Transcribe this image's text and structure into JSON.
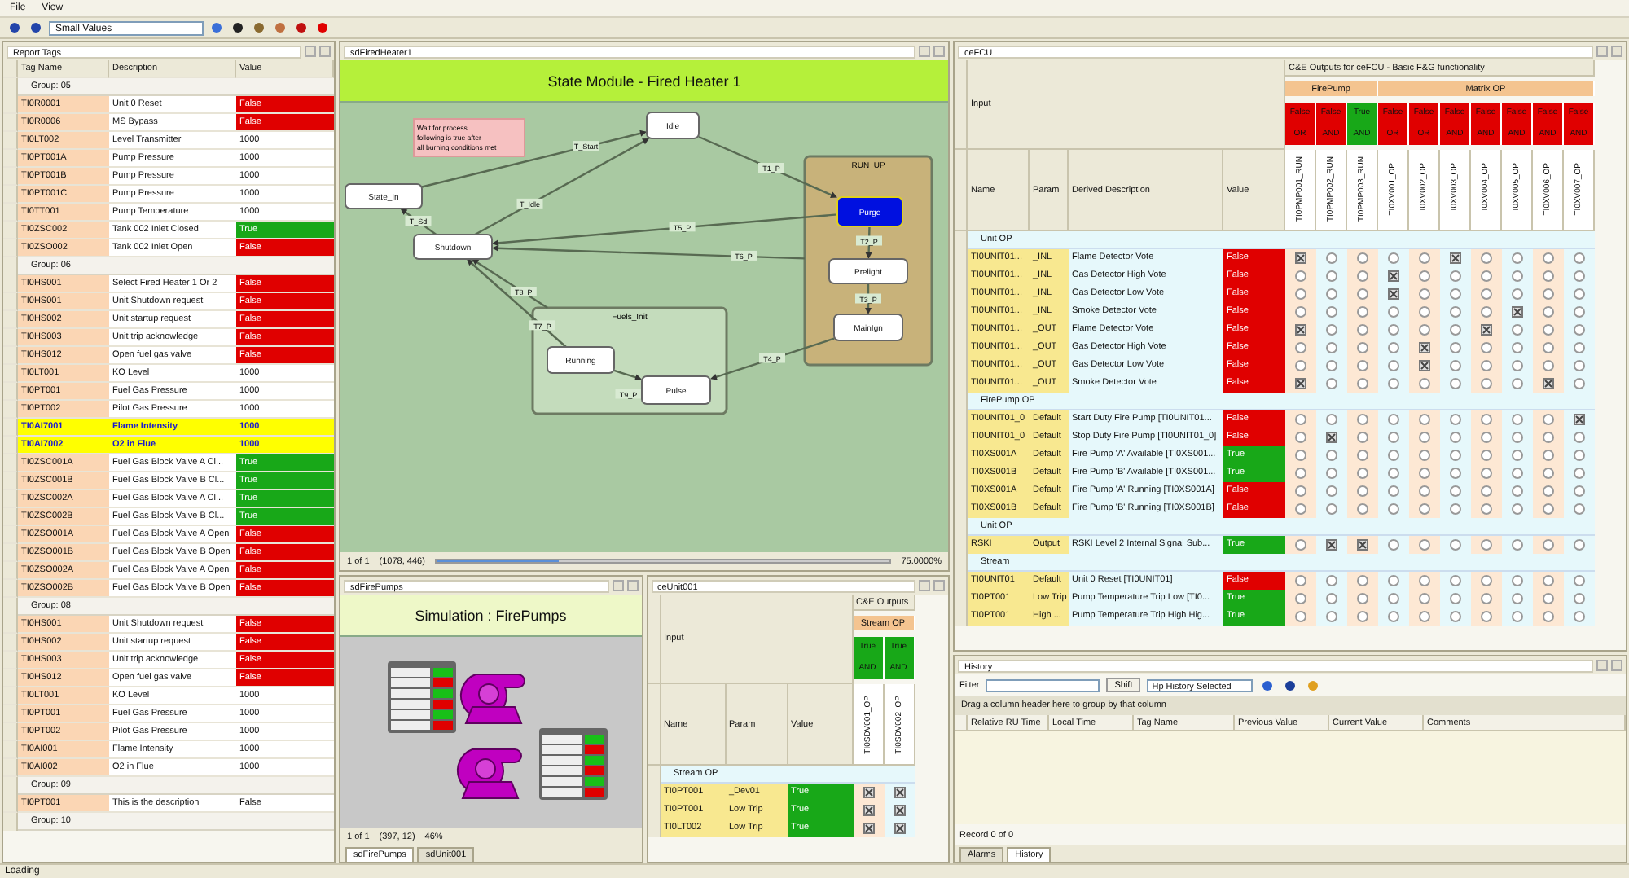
{
  "menu": [
    {
      "label": "File"
    },
    {
      "label": "View"
    }
  ],
  "toolbar": {
    "dropdown": "Small Values"
  },
  "report_tags": {
    "title": "Report Tags",
    "columns": [
      "Tag Name",
      "Description",
      "Value"
    ],
    "groups": [
      {
        "label": "Group: 05",
        "rows": [
          {
            "tag": "TI0R0001",
            "description": "Unit 0 Reset",
            "value": "False",
            "color": "#e00000"
          },
          {
            "tag": "TI0R0006",
            "description": "MS Bypass",
            "value": "False",
            "color": "#e00000"
          },
          {
            "tag": "TI0LT002",
            "description": "Level Transmitter",
            "value": "1000"
          },
          {
            "tag": "TI0PT001A",
            "description": "Pump Pressure",
            "value": "1000"
          },
          {
            "tag": "TI0PT001B",
            "description": "Pump Pressure",
            "value": "1000"
          },
          {
            "tag": "TI0PT001C",
            "description": "Pump Pressure",
            "value": "1000"
          },
          {
            "tag": "TI0TT001",
            "description": "Pump Temperature",
            "value": "1000"
          },
          {
            "tag": "TI0ZSC002",
            "description": "Tank 002 Inlet Closed",
            "value": "True",
            "color": "#18a818"
          },
          {
            "tag": "TI0ZSO002",
            "description": "Tank 002 Inlet Open",
            "value": "False",
            "color": "#e00000"
          }
        ]
      },
      {
        "label": "Group: 06",
        "rows": [
          {
            "tag": "TI0HS001",
            "description": "Select Fired Heater 1 Or 2",
            "value": "False",
            "color": "#e00000"
          },
          {
            "tag": "TI0HS001",
            "description": "Unit Shutdown request",
            "value": "False",
            "color": "#e00000"
          },
          {
            "tag": "TI0HS002",
            "description": "Unit startup request",
            "value": "False",
            "color": "#e00000"
          },
          {
            "tag": "TI0HS003",
            "description": "Unit trip acknowledge",
            "value": "False",
            "color": "#e00000"
          },
          {
            "tag": "TI0HS012",
            "description": "Open fuel gas valve",
            "value": "False",
            "color": "#e00000"
          },
          {
            "tag": "TI0LT001",
            "description": "KO Level",
            "value": "1000"
          },
          {
            "tag": "TI0PT001",
            "description": "Fuel Gas Pressure",
            "value": "1000"
          },
          {
            "tag": "TI0PT002",
            "description": "Pilot Gas Pressure",
            "value": "1000"
          },
          {
            "tag": "TI0AI7001",
            "description": "Flame Intensity",
            "value": "1000",
            "highlighted": true
          },
          {
            "tag": "TI0AI7002",
            "description": "O2 in Flue",
            "value": "1000",
            "highlighted": true
          },
          {
            "tag": "TI0ZSC001A",
            "description": "Fuel Gas Block Valve A Cl...",
            "value": "True",
            "color": "#18a818"
          },
          {
            "tag": "TI0ZSC001B",
            "description": "Fuel Gas Block Valve B Cl...",
            "value": "True",
            "color": "#18a818"
          },
          {
            "tag": "TI0ZSC002A",
            "description": "Fuel Gas Block Valve A Cl...",
            "value": "True",
            "color": "#18a818"
          },
          {
            "tag": "TI0ZSC002B",
            "description": "Fuel Gas Block Valve B Cl...",
            "value": "True",
            "color": "#18a818"
          },
          {
            "tag": "TI0ZSO001A",
            "description": "Fuel Gas Block Valve A Open",
            "value": "False",
            "color": "#e00000"
          },
          {
            "tag": "TI0ZSO001B",
            "description": "Fuel Gas Block Valve B Open",
            "value": "False",
            "color": "#e00000"
          },
          {
            "tag": "TI0ZSO002A",
            "description": "Fuel Gas Block Valve A Open",
            "value": "False",
            "color": "#e00000"
          },
          {
            "tag": "TI0ZSO002B",
            "description": "Fuel Gas Block Valve B Open",
            "value": "False",
            "color": "#e00000"
          }
        ]
      },
      {
        "label": "Group: 08",
        "rows": [
          {
            "tag": "TI0HS001",
            "description": "Unit Shutdown request",
            "value": "False",
            "color": "#e00000"
          },
          {
            "tag": "TI0HS002",
            "description": "Unit startup request",
            "value": "False",
            "color": "#e00000"
          },
          {
            "tag": "TI0HS003",
            "description": "Unit trip acknowledge",
            "value": "False",
            "color": "#e00000"
          },
          {
            "tag": "TI0HS012",
            "description": "Open fuel gas valve",
            "value": "False",
            "color": "#e00000"
          },
          {
            "tag": "TI0LT001",
            "description": "KO Level",
            "value": "1000"
          },
          {
            "tag": "TI0PT001",
            "description": "Fuel Gas Pressure",
            "value": "1000"
          },
          {
            "tag": "TI0PT002",
            "description": "Pilot Gas Pressure",
            "value": "1000"
          },
          {
            "tag": "TI0AI001",
            "description": "Flame Intensity",
            "value": "1000"
          },
          {
            "tag": "TI0AI002",
            "description": "O2 in Flue",
            "value": "1000"
          }
        ]
      },
      {
        "label": "Group: 09",
        "rows": [
          {
            "tag": "TI0PT001",
            "description": "This is the description",
            "value": "False"
          }
        ]
      },
      {
        "label": "Group: 10"
      }
    ]
  },
  "state_module": {
    "tab": "sdFiredHeater1",
    "title": "State Module - Fired Heater 1",
    "note": [
      "Wait for process",
      "following is true after",
      "all burning conditions met"
    ],
    "containers": [
      {
        "label": "RUN_UP"
      },
      {
        "label": "Fuels_Init"
      }
    ],
    "nodes": [
      {
        "label": "Idle",
        "selected": false
      },
      {
        "label": "State_In",
        "selected": false
      },
      {
        "label": "Shutdown",
        "selected": false
      },
      {
        "label": "Purge",
        "selected": true
      },
      {
        "label": "Prelight",
        "selected": false
      },
      {
        "label": "MainIgn",
        "selected": false
      },
      {
        "label": "Running",
        "selected": false
      },
      {
        "label": "Pulse",
        "selected": false
      }
    ],
    "transitions": [
      {
        "label": "T_Start"
      },
      {
        "label": "T_Idle"
      },
      {
        "label": "T1_P"
      },
      {
        "label": "T5_P"
      },
      {
        "label": "T6_P"
      },
      {
        "label": "T2_P"
      },
      {
        "label": "T3_P"
      },
      {
        "label": "T4_P"
      },
      {
        "label": "T_Sd"
      },
      {
        "label": "T7_P"
      },
      {
        "label": "T8_P"
      },
      {
        "label": "T9_P"
      }
    ],
    "page": "1 of 1",
    "cursor": "(1078, 446)",
    "zoom": "75.0000%",
    "zoom_slider": {
      "level": 0.27
    }
  },
  "fire_pumps": {
    "tab": "sdFirePumps",
    "title": "Simulation : FirePumps",
    "page": "1 of 1",
    "cursor": "(397, 12)",
    "zoom": "46%",
    "tabs": [
      {
        "label": "sdFirePumps",
        "selected": true
      },
      {
        "label": "sdUnit001",
        "selected": false
      }
    ]
  },
  "unit_matrix": {
    "tab": "ceUnit001",
    "input_label": "Input",
    "heading": "C&E Outputs",
    "columns": [
      "Name",
      "Param",
      "Value"
    ],
    "output_groups": [
      {
        "label": "Stream OP",
        "outputs": [
          {
            "state": "True",
            "logic": "AND",
            "name": "TI0SDV001_OP",
            "color": "#18a818"
          },
          {
            "state": "True",
            "logic": "AND",
            "name": "TI0SDV002_OP",
            "color": "#18a818"
          }
        ]
      }
    ],
    "row_groups": [
      {
        "label": "Stream OP",
        "rows": [
          {
            "name": "TI0PT001",
            "param": "_Dev01",
            "value": "True",
            "color": "#18a818",
            "marks": [
              true,
              true
            ]
          },
          {
            "name": "TI0PT001",
            "param": "Low Trip",
            "value": "True",
            "color": "#18a818",
            "marks": [
              true,
              true
            ]
          },
          {
            "name": "TI0LT002",
            "param": "Low Trip",
            "value": "True",
            "color": "#18a818",
            "marks": [
              true,
              true
            ]
          }
        ]
      }
    ]
  },
  "matrix": {
    "tab": "ceFCU",
    "input_label": "Input",
    "heading": "C&E Outputs for ceFCU - Basic F&G functionality",
    "columns": [
      "Name",
      "Param",
      "Derived Description",
      "Value"
    ],
    "output_groups": [
      {
        "label": "FirePump",
        "outputs": [
          {
            "state": "False",
            "logic": "OR",
            "name": "TI0PMP001_RUN",
            "color": "#e00000"
          },
          {
            "state": "False",
            "logic": "AND",
            "name": "TI0PMP002_RUN",
            "color": "#e00000"
          },
          {
            "state": "True",
            "logic": "AND",
            "name": "TI0PMP003_RUN",
            "color": "#18a818"
          }
        ]
      },
      {
        "label": "Matrix OP",
        "outputs": [
          {
            "state": "False",
            "logic": "OR",
            "name": "TI0XV001_OP",
            "color": "#e00000"
          },
          {
            "state": "False",
            "logic": "OR",
            "name": "TI0XV002_OP",
            "color": "#e00000"
          },
          {
            "state": "False",
            "logic": "AND",
            "name": "TI0XV003_OP",
            "color": "#e00000"
          },
          {
            "state": "False",
            "logic": "AND",
            "name": "TI0XV004_OP",
            "color": "#e00000"
          },
          {
            "state": "False",
            "logic": "AND",
            "name": "TI0XV005_OP",
            "color": "#e00000"
          },
          {
            "state": "False",
            "logic": "AND",
            "name": "TI0XV006_OP",
            "color": "#e00000"
          },
          {
            "state": "False",
            "logic": "AND",
            "name": "TI0XV007_OP",
            "color": "#e00000"
          }
        ]
      }
    ],
    "row_groups": [
      {
        "label": "Unit OP",
        "rows": [
          {
            "name": "TI0UNIT01...",
            "param": "_INL",
            "description": "Flame Detector Vote",
            "value": "False",
            "color": "#e00000",
            "marks": [
              true,
              false,
              false,
              false,
              false,
              true,
              false,
              false,
              false,
              false
            ]
          },
          {
            "name": "TI0UNIT01...",
            "param": "_INL",
            "description": "Gas Detector High Vote",
            "value": "False",
            "color": "#e00000",
            "marks": [
              false,
              false,
              false,
              true,
              false,
              false,
              false,
              false,
              false,
              false
            ]
          },
          {
            "name": "TI0UNIT01...",
            "param": "_INL",
            "description": "Gas Detector Low Vote",
            "value": "False",
            "color": "#e00000",
            "marks": [
              false,
              false,
              false,
              true,
              false,
              false,
              false,
              false,
              false,
              false
            ]
          },
          {
            "name": "TI0UNIT01...",
            "param": "_INL",
            "description": "Smoke Detector Vote",
            "value": "False",
            "color": "#e00000",
            "marks": [
              false,
              false,
              false,
              false,
              false,
              false,
              false,
              true,
              false,
              false
            ]
          },
          {
            "name": "TI0UNIT01...",
            "param": "_OUT",
            "description": "Flame Detector Vote",
            "value": "False",
            "color": "#e00000",
            "marks": [
              true,
              false,
              false,
              false,
              false,
              false,
              true,
              false,
              false,
              false
            ]
          },
          {
            "name": "TI0UNIT01...",
            "param": "_OUT",
            "description": "Gas Detector High Vote",
            "value": "False",
            "color": "#e00000",
            "marks": [
              false,
              false,
              false,
              false,
              true,
              false,
              false,
              false,
              false,
              false
            ]
          },
          {
            "name": "TI0UNIT01...",
            "param": "_OUT",
            "description": "Gas Detector Low Vote",
            "value": "False",
            "color": "#e00000",
            "marks": [
              false,
              false,
              false,
              false,
              true,
              false,
              false,
              false,
              false,
              false
            ]
          },
          {
            "name": "TI0UNIT01...",
            "param": "_OUT",
            "description": "Smoke Detector Vote",
            "value": "False",
            "color": "#e00000",
            "marks": [
              true,
              false,
              false,
              false,
              false,
              false,
              false,
              false,
              true,
              false
            ]
          }
        ]
      },
      {
        "label": "FirePump OP",
        "rows": [
          {
            "name": "TI0UNIT01_0",
            "param": "Default",
            "description": "Start Duty Fire Pump [TI0UNIT01...",
            "value": "False",
            "color": "#e00000",
            "marks": [
              false,
              false,
              false,
              false,
              false,
              false,
              false,
              false,
              false,
              true
            ]
          },
          {
            "name": "TI0UNIT01_0",
            "param": "Default",
            "description": "Stop Duty Fire Pump [TI0UNIT01_0]",
            "value": "False",
            "color": "#e00000",
            "marks": [
              false,
              true,
              false,
              false,
              false,
              false,
              false,
              false,
              false,
              false
            ]
          },
          {
            "name": "TI0XS001A",
            "param": "Default",
            "description": "Fire Pump 'A' Available [TI0XS001...",
            "value": "True",
            "color": "#18a818",
            "marks": [
              false,
              false,
              false,
              false,
              false,
              false,
              false,
              false,
              false,
              false
            ]
          },
          {
            "name": "TI0XS001B",
            "param": "Default",
            "description": "Fire Pump 'B' Available [TI0XS001...",
            "value": "True",
            "color": "#18a818",
            "marks": [
              false,
              false,
              false,
              false,
              false,
              false,
              false,
              false,
              false,
              false
            ]
          },
          {
            "name": "TI0XS001A",
            "param": "Default",
            "description": "Fire Pump 'A' Running [TI0XS001A]",
            "value": "False",
            "color": "#e00000",
            "marks": [
              false,
              false,
              false,
              false,
              false,
              false,
              false,
              false,
              false,
              false
            ]
          },
          {
            "name": "TI0XS001B",
            "param": "Default",
            "description": "Fire Pump 'B' Running [TI0XS001B]",
            "value": "False",
            "color": "#e00000",
            "marks": [
              false,
              false,
              false,
              false,
              false,
              false,
              false,
              false,
              false,
              false
            ]
          }
        ]
      },
      {
        "label": "Unit OP",
        "rows": [
          {
            "name": "RSKI",
            "param": "Output",
            "description": "RSKI Level 2 Internal Signal Sub...",
            "value": "True",
            "color": "#18a818",
            "marks": [
              false,
              true,
              true,
              false,
              false,
              false,
              false,
              false,
              false,
              false
            ]
          }
        ]
      },
      {
        "label": "Stream",
        "rows": [
          {
            "name": "TI0UNIT01",
            "param": "Default",
            "description": "Unit 0 Reset [TI0UNIT01]",
            "value": "False",
            "color": "#e00000",
            "marks": [
              false,
              false,
              false,
              false,
              false,
              false,
              false,
              false,
              false,
              false
            ]
          },
          {
            "name": "TI0PT001",
            "param": "Low Trip",
            "description": "Pump Temperature Trip Low [TI0...",
            "value": "True",
            "color": "#18a818",
            "marks": [
              false,
              false,
              false,
              false,
              false,
              false,
              false,
              false,
              false,
              false
            ]
          },
          {
            "name": "TI0PT001",
            "param": "High ...",
            "description": "Pump Temperature Trip High Hig...",
            "value": "True",
            "color": "#18a818",
            "marks": [
              false,
              false,
              false,
              false,
              false,
              false,
              false,
              false,
              false,
              false
            ]
          }
        ]
      }
    ]
  },
  "history": {
    "title": "History",
    "filter_label": "Filter",
    "shift_button": "Shift",
    "selection": "Hp History Selected",
    "group_hint": "Drag a column header here to group by that column",
    "columns": [
      "Relative RU Time",
      "Local Time",
      "Tag Name",
      "Previous Value",
      "Current Value",
      "Comments"
    ],
    "record": "Record 0 of 0",
    "tabs": [
      {
        "label": "Alarms",
        "selected": false
      },
      {
        "label": "History",
        "selected": true
      }
    ]
  },
  "status_bar": "Loading"
}
